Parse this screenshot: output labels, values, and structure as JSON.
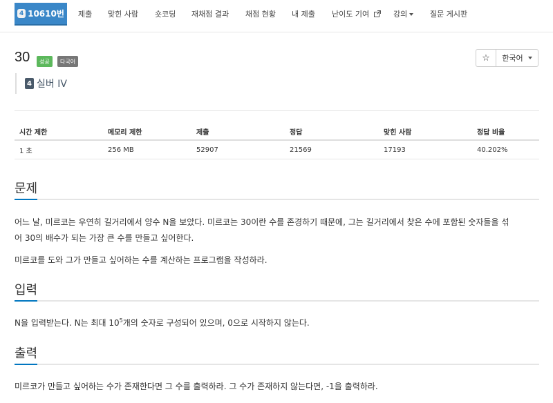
{
  "nav": {
    "active": {
      "tier": "4",
      "label": "10610번"
    },
    "items": [
      {
        "label": "제출"
      },
      {
        "label": "맞힌 사람"
      },
      {
        "label": "숏코딩"
      },
      {
        "label": "재채점 결과"
      },
      {
        "label": "채점 현황"
      },
      {
        "label": "내 제출"
      },
      {
        "label": "난이도 기여"
      },
      {
        "label": "강의"
      },
      {
        "label": "질문 게시판"
      }
    ]
  },
  "header": {
    "problem_number": "30",
    "labels": {
      "success": "성공",
      "multi_language": "다국어"
    },
    "tier": {
      "badge": "4",
      "name": "실버 IV"
    },
    "star_icon": "☆",
    "language": "한국어"
  },
  "info": {
    "headers": [
      "시간 제한",
      "메모리 제한",
      "제출",
      "정답",
      "맞힌 사람",
      "정답 비율"
    ],
    "values": [
      "1 초",
      "256 MB",
      "52907",
      "21569",
      "17193",
      "40.202%"
    ]
  },
  "sections": {
    "problem": {
      "title": "문제",
      "p1_line1": "어느 날, 미르코는 우연히 길거리에서 양수 N을 보았다. 미르코는 30이란 수를 존경하기 때문에, 그는 길거리에서 찾은 수에 포함된 숫자들을 섞",
      "p1_line2": "어 30의 배수가 되는 가장 큰 수를 만들고 싶어한다.",
      "p2": "미르코를 도와 그가 만들고 싶어하는 수를 계산하는 프로그램을 작성하라."
    },
    "input": {
      "title": "입력",
      "text_before": "N을 입력받는다. N는 최대 10",
      "superscript": "5",
      "text_after": "개의 숫자로 구성되어 있으며, 0으로 시작하지 않는다."
    },
    "output": {
      "title": "출력",
      "text": "미르코가 만들고 싶어하는 수가 존재한다면 그 수를 출력하라. 그 수가 존재하지 않는다면, -1을 출력하라."
    }
  },
  "colors": {
    "nav_active": "#3a87c8",
    "label_success": "#5cb85c",
    "label_multi": "#777777",
    "section_accent": "#0076c0"
  }
}
